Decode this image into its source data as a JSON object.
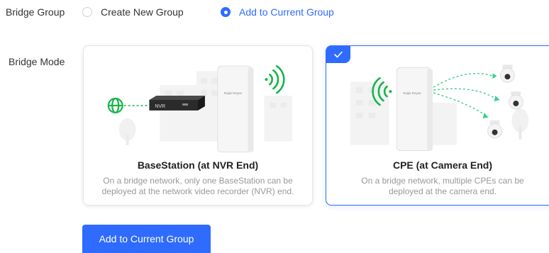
{
  "bridge_group": {
    "label": "Bridge Group",
    "options": [
      {
        "label": "Create New Group",
        "selected": false
      },
      {
        "label": "Add to Current Group",
        "selected": true
      }
    ]
  },
  "bridge_mode": {
    "label": "Bridge Mode",
    "cards": [
      {
        "title": "BaseStation (at NVR End)",
        "description_line1": "On a bridge network, only one BaseStation can be",
        "description_line2": "deployed at the network video recorder (NVR) end.",
        "nvr_label": "NVR",
        "device_brand": "Ruijie Reyee",
        "selected": false
      },
      {
        "title": "CPE (at Camera End)",
        "description_line1": "On a bridge network, multiple CPEs can be",
        "description_line2": "deployed at the camera end.",
        "device_brand": "Ruijie Reyee",
        "selected": true
      }
    ]
  },
  "submit": {
    "label": "Add to Current Group"
  },
  "colors": {
    "primary": "#2f6bff",
    "green": "#16b54a",
    "text": "#333333",
    "muted": "#999999"
  }
}
